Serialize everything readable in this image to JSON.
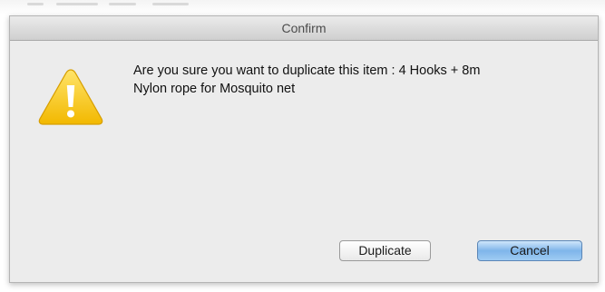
{
  "dialog": {
    "title": "Confirm",
    "message_line1": "Are you sure you want to duplicate this item : 4 Hooks + 8m",
    "message_line2": "Nylon rope for Mosquito net",
    "icon": "warning-icon",
    "buttons": {
      "duplicate_label": "Duplicate",
      "cancel_label": "Cancel"
    }
  },
  "colors": {
    "dialog_background": "#ececec",
    "warning_yellow": "#f5c400",
    "default_button_blue": "#8cbff0"
  }
}
